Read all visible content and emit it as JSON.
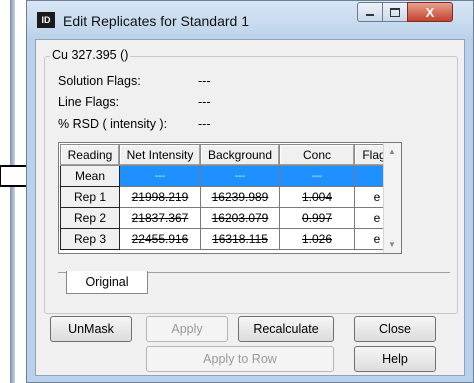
{
  "window": {
    "title": "Edit Replicates for Standard 1",
    "app_icon_label": "ID"
  },
  "titlebar_buttons": {
    "close_label": "X"
  },
  "group": {
    "title": "Cu 327.395 ()",
    "info": [
      {
        "label": "Solution Flags:",
        "value": "---"
      },
      {
        "label": "Line Flags:",
        "value": "---"
      },
      {
        "label": "% RSD ( intensity ):",
        "value": "---"
      }
    ]
  },
  "grid": {
    "columns": [
      "Reading",
      "Net Intensity",
      "Background",
      "Conc",
      "Flags"
    ],
    "rows": [
      {
        "name": "Mean",
        "net": "---",
        "bg": "---",
        "conc": "---",
        "flags": ""
      },
      {
        "name": "Rep 1",
        "net": "21998.219",
        "bg": "16239.989",
        "conc": "1.004",
        "flags": "e"
      },
      {
        "name": "Rep 2",
        "net": "21837.367",
        "bg": "16203.079",
        "conc": "0.997",
        "flags": "e"
      },
      {
        "name": "Rep 3",
        "net": "22455.916",
        "bg": "16318.115",
        "conc": "1.026",
        "flags": "e"
      }
    ]
  },
  "tabs": {
    "active": "Original"
  },
  "buttons": {
    "unmask": "UnMask",
    "apply": "Apply",
    "recalculate": "Recalculate",
    "close": "Close",
    "apply_to_row": "Apply to Row",
    "help": "Help"
  }
}
